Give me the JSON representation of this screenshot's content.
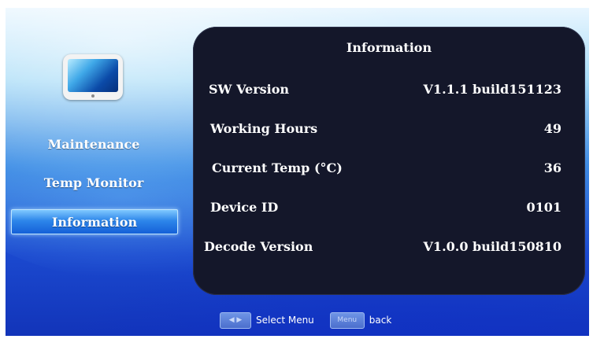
{
  "sidebar": {
    "items": [
      {
        "label": "Maintenance",
        "selected": false
      },
      {
        "label": "Temp Monitor",
        "selected": false
      },
      {
        "label": "Information",
        "selected": true
      }
    ]
  },
  "panel": {
    "title": "Information",
    "rows": [
      {
        "label": "SW Version",
        "value": "V1.1.1 build151123"
      },
      {
        "label": "Working Hours",
        "value": "49"
      },
      {
        "label": "Current Temp (°C)",
        "value": "36"
      },
      {
        "label": "Device ID",
        "value": "0101"
      },
      {
        "label": "Decode Version",
        "value": "V1.0.0 build150810"
      }
    ]
  },
  "footer": {
    "arrow_key": "◀ ▶",
    "select_label": "Select Menu",
    "menu_key": "Menu",
    "back_label": "back"
  },
  "colors": {
    "panel_bg": "#14172a",
    "selected_item": "#2d86ea",
    "text": "#ffffff"
  },
  "icons": [
    "monitor-device-icon",
    "left-right-arrows-icon"
  ]
}
